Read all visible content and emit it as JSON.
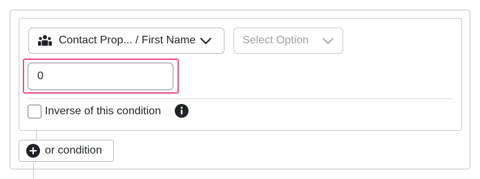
{
  "condition": {
    "property_select": {
      "label": "Contact Prop... / First Name",
      "icon": "contacts-group-icon"
    },
    "operator_select": {
      "placeholder": "Select Option",
      "icon": "chevron-down-icon"
    },
    "value_input": {
      "value": "0"
    },
    "inverse_checkbox": {
      "label": "Inverse of this condition",
      "checked": false,
      "info_icon": "info-icon"
    }
  },
  "or_condition_button": {
    "label": "or condition",
    "icon": "plus-circle-icon"
  },
  "colors": {
    "highlight": "#ee4d8c",
    "border": "#c6c9ce",
    "placeholder_text": "#9aa0a6"
  }
}
